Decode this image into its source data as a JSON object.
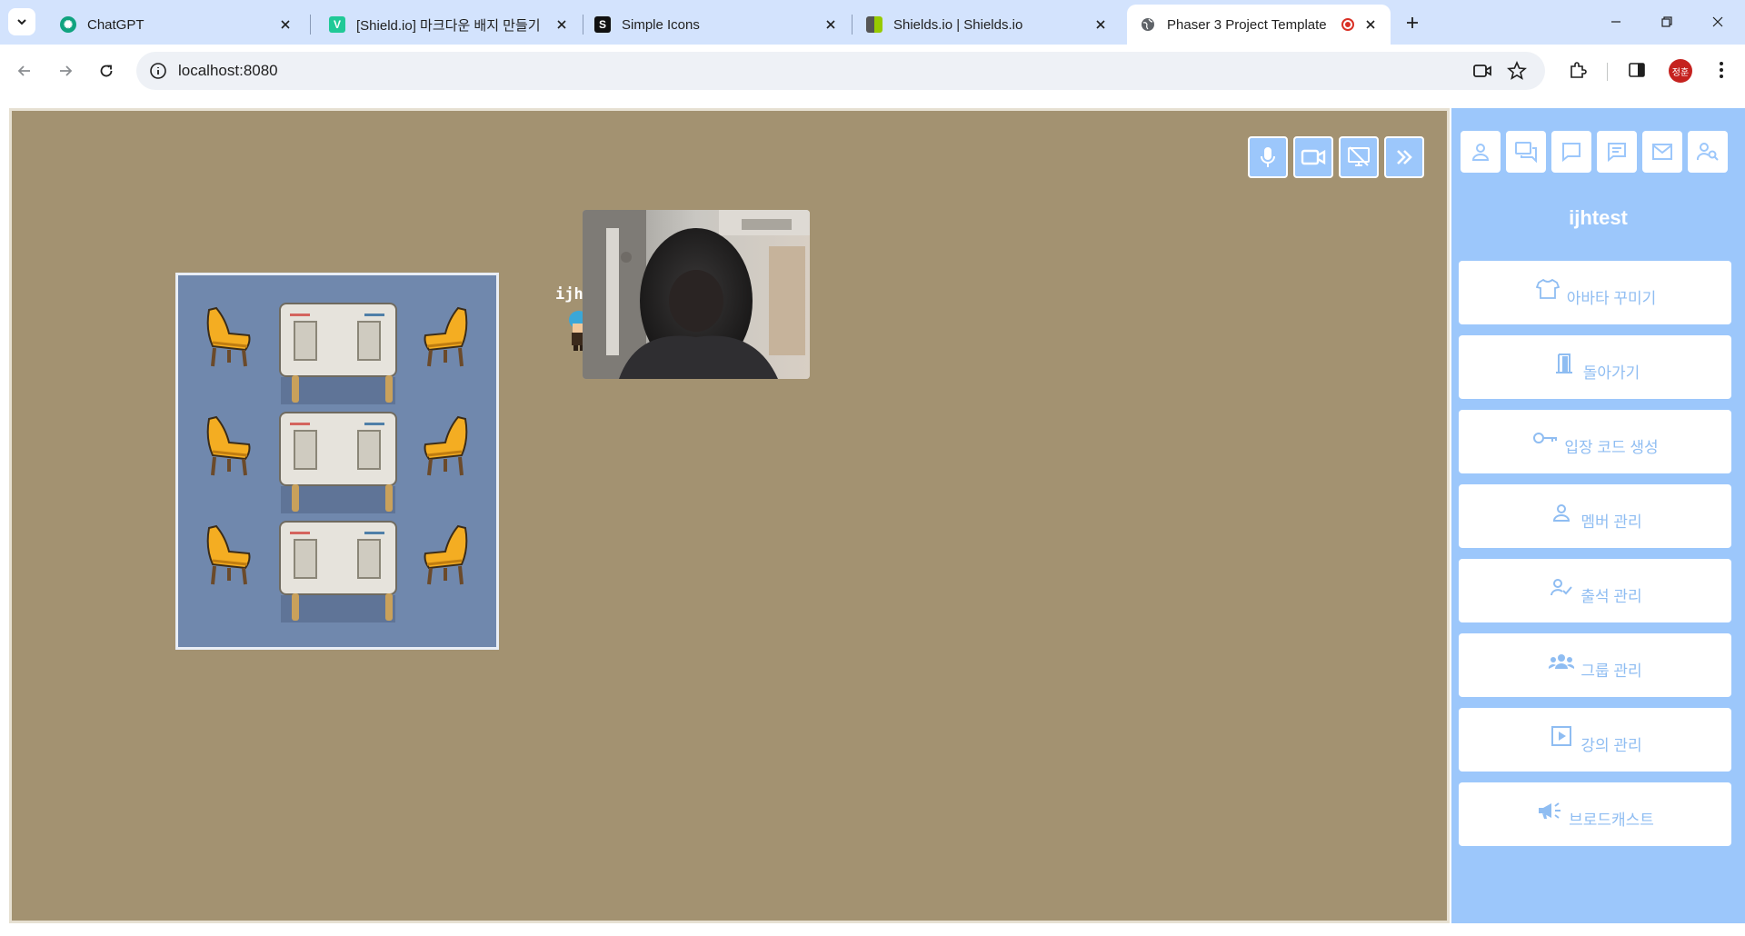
{
  "browser": {
    "tabs": [
      {
        "title": "ChatGPT",
        "favicon": "chatgpt-icon",
        "color": "#10a37f"
      },
      {
        "title": "[Shield.io] 마크다운 배지 만들기",
        "favicon": "velog-icon",
        "color": "#20c997"
      },
      {
        "title": "Simple Icons",
        "favicon": "simple-icons-icon",
        "color": "#111111"
      },
      {
        "title": "Shields.io | Shields.io",
        "favicon": "shields-icon",
        "color": "#97ca00"
      },
      {
        "title": "Phaser 3 Project Template",
        "favicon": "globe-icon",
        "active": true
      }
    ],
    "url": "localhost:8080",
    "profile_initials": "정훈"
  },
  "game": {
    "player_name": "ijhtest",
    "controls": [
      "mic-icon",
      "video-camera-icon",
      "screen-share-off-icon",
      "double-chevron-right-icon"
    ],
    "colors": {
      "floor": "#a39271",
      "room": "#7088ad",
      "button": "#9cc7fb"
    }
  },
  "sidebar": {
    "top_icons": [
      "person-icon",
      "chats-icon",
      "chat-bubble-icon",
      "message-icon",
      "mail-icon",
      "user-search-icon"
    ],
    "username": "ijhtest",
    "menu": [
      {
        "label": "아바타 꾸미기",
        "icon": "shirt-icon"
      },
      {
        "label": "돌아가기",
        "icon": "door-icon"
      },
      {
        "label": "입장 코드 생성",
        "icon": "key-icon"
      },
      {
        "label": "멤버 관리",
        "icon": "person-icon"
      },
      {
        "label": "출석 관리",
        "icon": "person-check-icon"
      },
      {
        "label": "그룹 관리",
        "icon": "group-icon"
      },
      {
        "label": "강의 관리",
        "icon": "play-square-icon"
      },
      {
        "label": "브로드캐스트",
        "icon": "megaphone-icon"
      }
    ]
  }
}
